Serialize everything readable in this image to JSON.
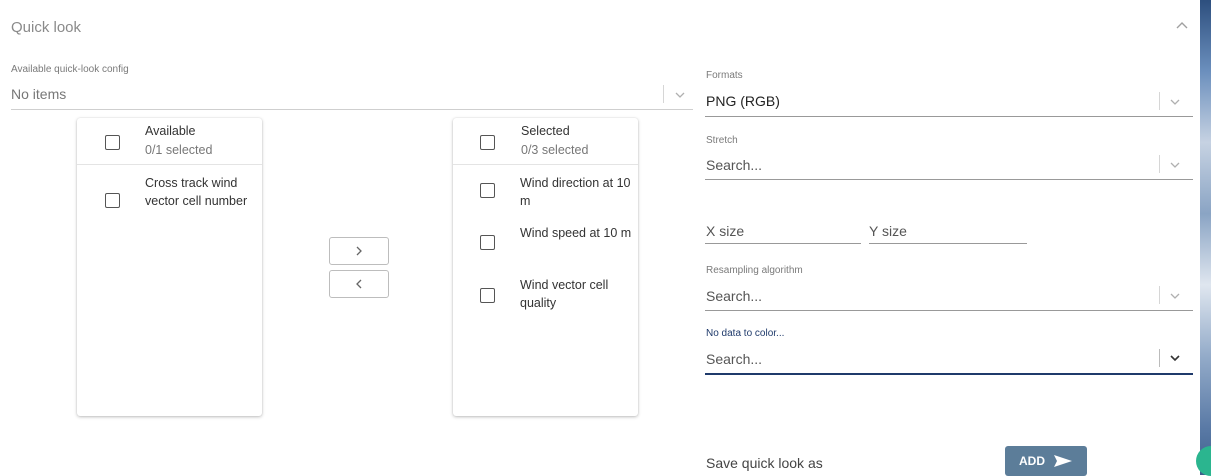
{
  "section": {
    "title": "Quick look"
  },
  "available_config": {
    "label": "Available quick-look config",
    "value": "No items"
  },
  "available_list": {
    "title": "Available",
    "count": "0/1 selected",
    "items": [
      {
        "label": "Cross track wind vector cell number",
        "checked": false
      }
    ]
  },
  "selected_list": {
    "title": "Selected",
    "count": "0/3 selected",
    "items": [
      {
        "label": "Wind direction at 10 m",
        "checked": false
      },
      {
        "label": "Wind speed at 10 m",
        "checked": false
      },
      {
        "label": "Wind vector cell quality",
        "checked": false
      }
    ]
  },
  "transfer": {
    "right_icon": "chevron-right-icon",
    "left_icon": "chevron-left-icon"
  },
  "formats": {
    "label": "Formats",
    "value": "PNG (RGB)"
  },
  "stretch": {
    "label": "Stretch",
    "placeholder": "Search..."
  },
  "size": {
    "x_placeholder": "X size",
    "y_placeholder": "Y size"
  },
  "resampling": {
    "label": "Resampling algorithm",
    "placeholder": "Search..."
  },
  "nodata": {
    "label": "No data to color...",
    "placeholder": "Search...",
    "accent": "#1f3a6b"
  },
  "save": {
    "label": "Save quick look as",
    "add_label": "ADD",
    "add_icon": "send-icon",
    "button_color": "#5c7d99"
  }
}
